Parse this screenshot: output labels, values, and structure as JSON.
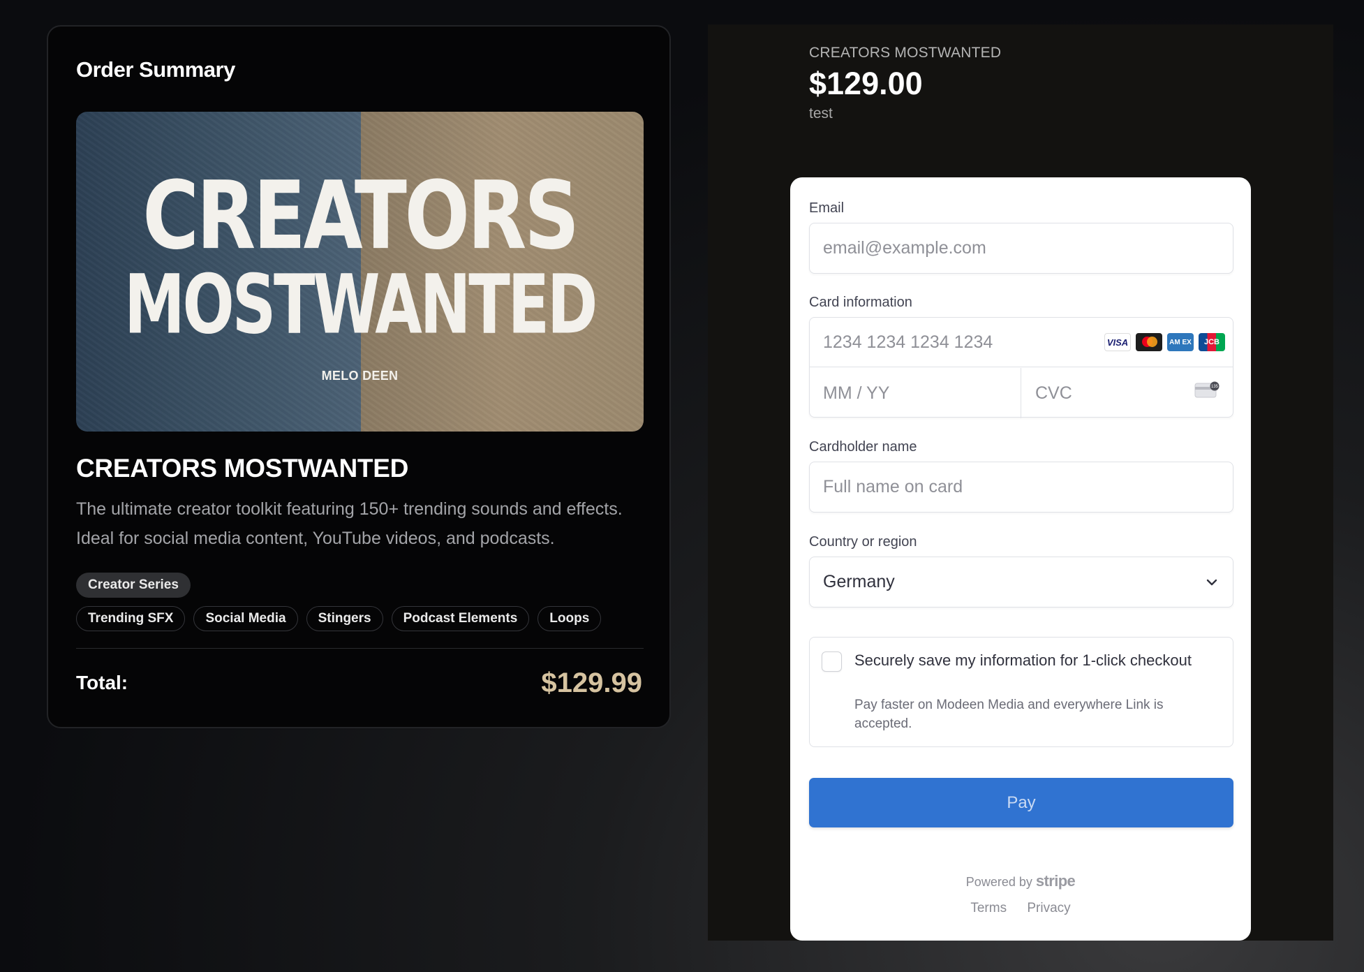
{
  "order": {
    "title": "Order Summary",
    "cover": {
      "line1": "CREATORS",
      "line2": "MOSTWANTED",
      "artist": "MELO DEEN"
    },
    "product_name": "CREATORS MOSTWANTED",
    "description": "The ultimate creator toolkit featuring 150+ trending sounds and effects. Ideal for social media content, YouTube videos, and podcasts.",
    "series": "Creator Series",
    "tags": [
      "Trending SFX",
      "Social Media",
      "Stingers",
      "Podcast Elements",
      "Loops"
    ],
    "total_label": "Total:",
    "total_value": "$129.99"
  },
  "checkout": {
    "merchant": "CREATORS MOSTWANTED",
    "amount": "$129.00",
    "description": "test",
    "email": {
      "label": "Email",
      "placeholder": "email@example.com"
    },
    "card": {
      "label": "Card information",
      "number_placeholder": "1234 1234 1234 1234",
      "expiry_placeholder": "MM / YY",
      "cvc_placeholder": "CVC",
      "brands": [
        "visa-icon",
        "mastercard-icon",
        "amex-icon",
        "jcb-icon"
      ],
      "brand_labels": {
        "visa": "VISA",
        "amex": "AM EX",
        "jcb": "JCB"
      },
      "cvc_badge": "135"
    },
    "cardholder": {
      "label": "Cardholder name",
      "placeholder": "Full name on card"
    },
    "country": {
      "label": "Country or region",
      "value": "Germany"
    },
    "save": {
      "title": "Securely save my information for 1-click checkout",
      "subtitle": "Pay faster on Modeen Media and everywhere Link is accepted."
    },
    "pay_label": "Pay",
    "powered_by": "Powered by",
    "powered_brand": "stripe",
    "links": {
      "terms": "Terms",
      "privacy": "Privacy"
    }
  },
  "colors": {
    "accent": "#3073d1",
    "price": "#d6c3a0",
    "panel_bg": "#131210"
  }
}
